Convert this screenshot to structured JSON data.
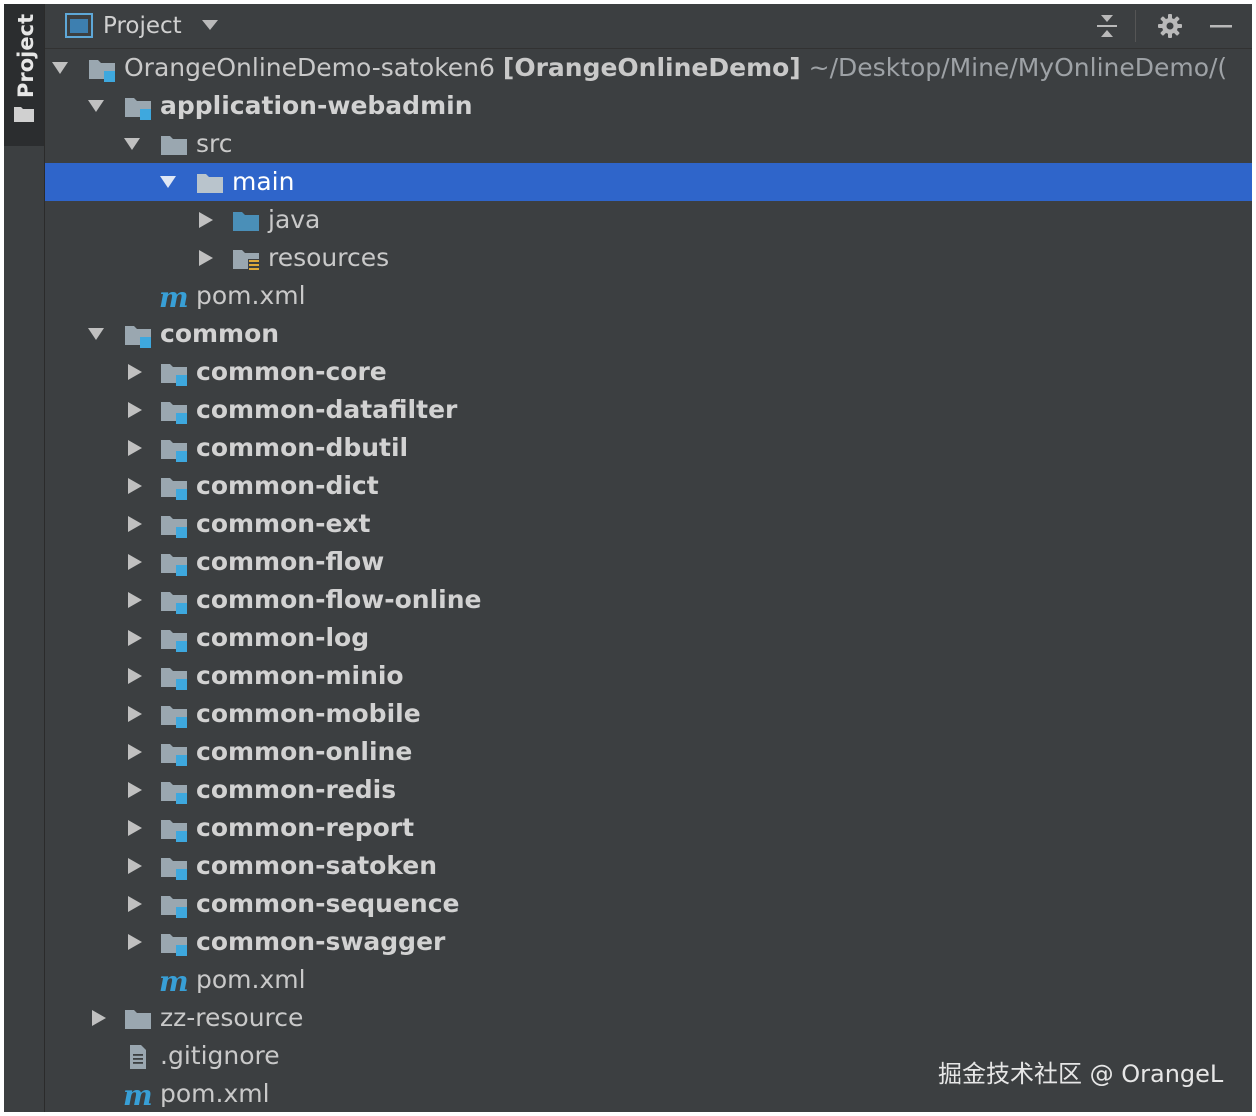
{
  "side_tab": {
    "label": "Project"
  },
  "header": {
    "title": "Project"
  },
  "tree": {
    "root": {
      "name": "OrangeOnlineDemo-satoken6",
      "module": "[OrangeOnlineDemo]",
      "path": "~/Desktop/Mine/MyOnlineDemo/("
    },
    "application_webadmin": "application-webadmin",
    "src": "src",
    "main": "main",
    "java": "java",
    "resources": "resources",
    "app_pom": "pom.xml",
    "common": "common",
    "common_modules": [
      "common-core",
      "common-datafilter",
      "common-dbutil",
      "common-dict",
      "common-ext",
      "common-flow",
      "common-flow-online",
      "common-log",
      "common-minio",
      "common-mobile",
      "common-online",
      "common-redis",
      "common-report",
      "common-satoken",
      "common-sequence",
      "common-swagger"
    ],
    "common_pom": "pom.xml",
    "zz_resource": "zz-resource",
    "gitignore": ".gitignore",
    "root_pom": "pom.xml"
  },
  "watermark": "掘金技术社区 @ OrangeL",
  "colors": {
    "selection": "#2f65ca",
    "module_badge": "#3ea8de",
    "folder": "#9aa7b0",
    "source_folder": "#4a8fb8",
    "maven_m": "#389fd6"
  }
}
